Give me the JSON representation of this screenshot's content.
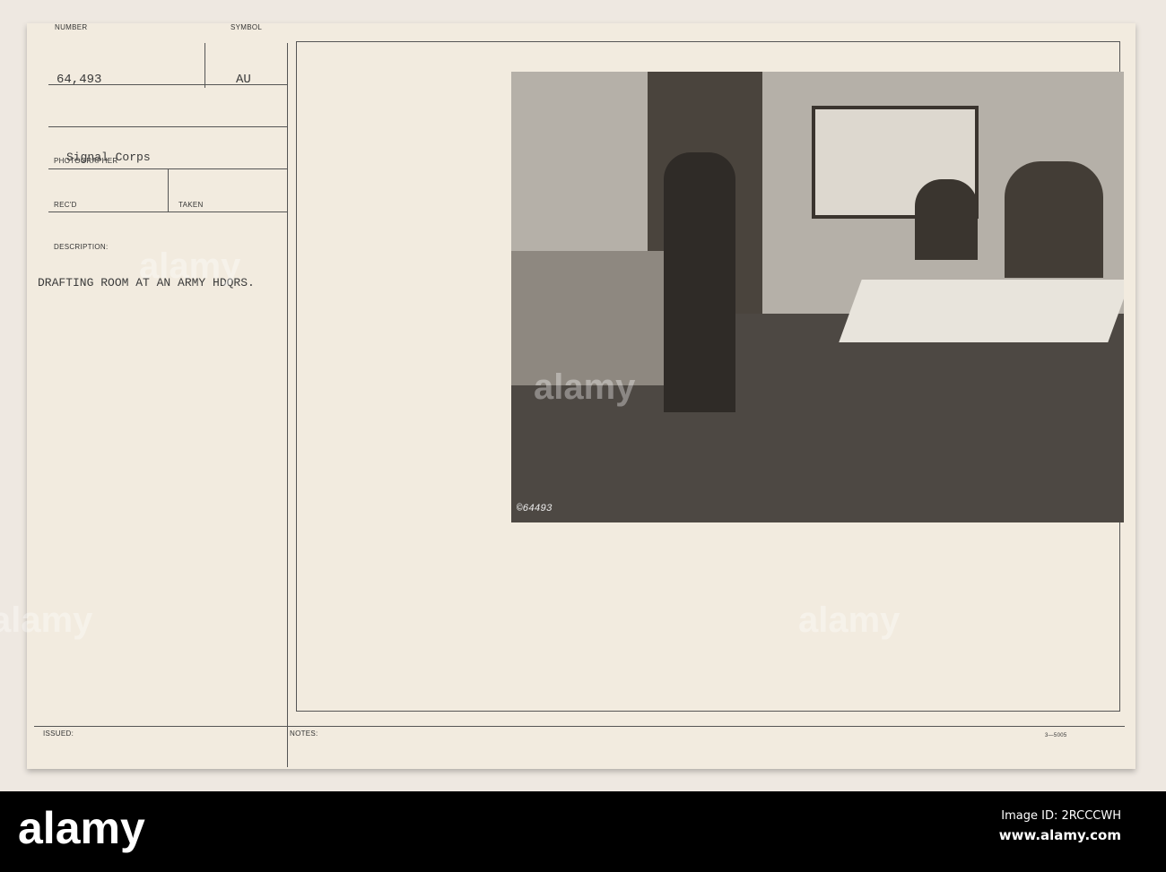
{
  "card": {
    "number_label": "NUMBER",
    "number": "64,493",
    "symbol_label": "SYMBOL",
    "symbol": "AU",
    "photographer_label": "PHOTOGRAPHER",
    "photographer": "Signal Corps",
    "recd_label": "REC'D",
    "taken_label": "TAKEN",
    "description_label": "DESCRIPTION:",
    "description": "DRAFTING ROOM AT AN ARMY HDQRS.",
    "issued_label": "ISSUED:",
    "notes_label": "NOTES:",
    "form_number": "3—5005",
    "photo_number": "©64493"
  },
  "footer": {
    "logo": "alamy",
    "image_id": "Image ID: 2RCCCWH",
    "url": "www.alamy.com"
  }
}
